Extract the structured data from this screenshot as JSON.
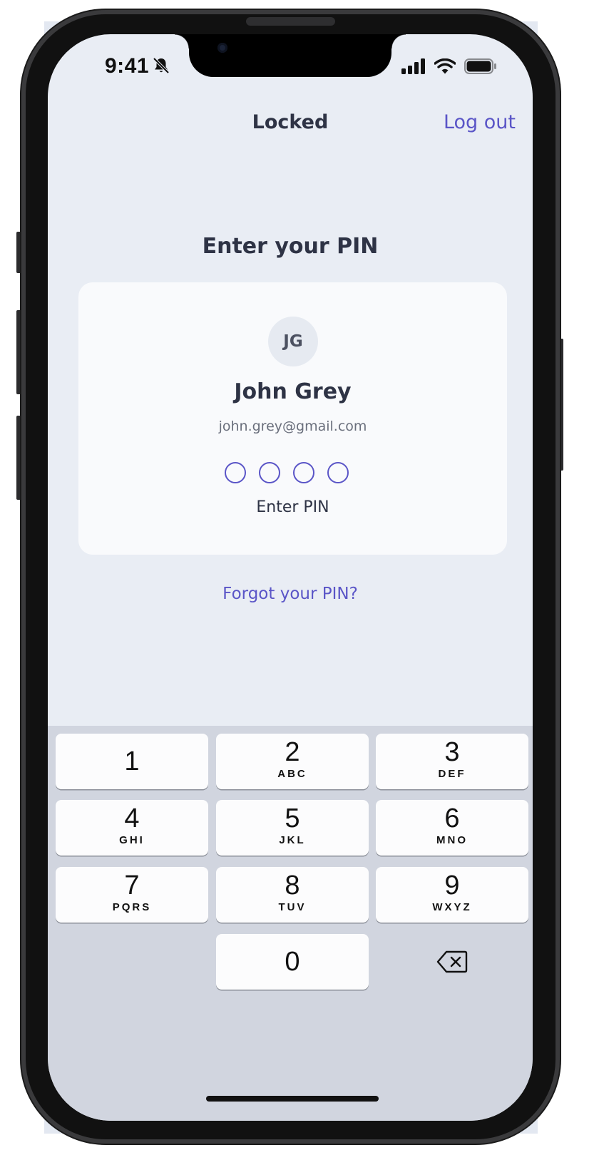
{
  "status_bar": {
    "time": "9:41"
  },
  "nav": {
    "title": "Locked",
    "logout_label": "Log out"
  },
  "heading": "Enter your PIN",
  "user": {
    "initials": "JG",
    "name": "John Grey",
    "email": "john.grey@gmail.com"
  },
  "pin": {
    "length": 4,
    "label": "Enter PIN"
  },
  "forgot_label": "Forgot your PIN?",
  "keypad": {
    "keys": [
      {
        "digit": "1",
        "letters": ""
      },
      {
        "digit": "2",
        "letters": "ABC"
      },
      {
        "digit": "3",
        "letters": "DEF"
      },
      {
        "digit": "4",
        "letters": "GHI"
      },
      {
        "digit": "5",
        "letters": "JKL"
      },
      {
        "digit": "6",
        "letters": "MNO"
      },
      {
        "digit": "7",
        "letters": "PQRS"
      },
      {
        "digit": "8",
        "letters": "TUV"
      },
      {
        "digit": "9",
        "letters": "WXYZ"
      },
      {
        "digit": "0",
        "letters": ""
      }
    ]
  },
  "colors": {
    "accent": "#5a55c7",
    "screen_bg": "#e9edf4",
    "card_bg": "#f9fafc",
    "keypad_bg": "#d1d5df"
  },
  "icons": [
    "bell-slash-icon",
    "cellular-signal-icon",
    "wifi-icon",
    "battery-icon",
    "backspace-icon"
  ]
}
